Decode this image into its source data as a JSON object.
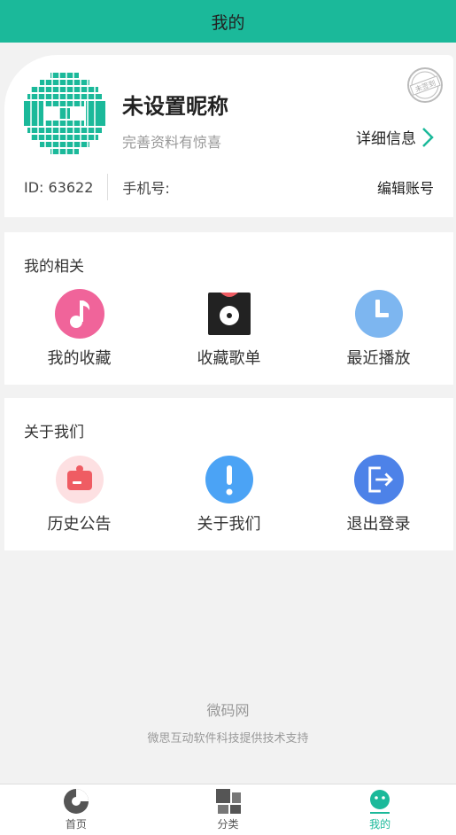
{
  "header": {
    "title": "我的"
  },
  "profile": {
    "nickname": "未设置昵称",
    "subtitle": "完善资料有惊喜",
    "detail_label": "详细信息",
    "id_text": "ID: 63622",
    "phone_label": "手机号:",
    "edit_label": "编辑账号",
    "stamp_text": "未签到"
  },
  "section_related": {
    "title": "我的相关",
    "items": [
      {
        "label": "我的收藏",
        "icon": "music-note-icon"
      },
      {
        "label": "收藏歌单",
        "icon": "vinyl-record-icon"
      },
      {
        "label": "最近播放",
        "icon": "clock-icon"
      }
    ]
  },
  "section_about": {
    "title": "关于我们",
    "items": [
      {
        "label": "历史公告",
        "icon": "announcement-icon"
      },
      {
        "label": "关于我们",
        "icon": "exclamation-icon"
      },
      {
        "label": "退出登录",
        "icon": "logout-icon"
      }
    ]
  },
  "footer": {
    "brand": "微码网",
    "support": "微思互动软件科技提供技术支持"
  },
  "tabbar": {
    "tabs": [
      {
        "label": "首页",
        "icon": "home-pie-icon"
      },
      {
        "label": "分类",
        "icon": "category-grid-icon"
      },
      {
        "label": "我的",
        "icon": "smile-face-icon"
      }
    ],
    "active_index": 2
  },
  "colors": {
    "accent": "#1bb99a",
    "pink": "#f0649a",
    "blue": "#4ba3f5",
    "light_blue": "#7db6f0",
    "logout_blue": "#4d82e8",
    "red": "#ef5c63"
  }
}
